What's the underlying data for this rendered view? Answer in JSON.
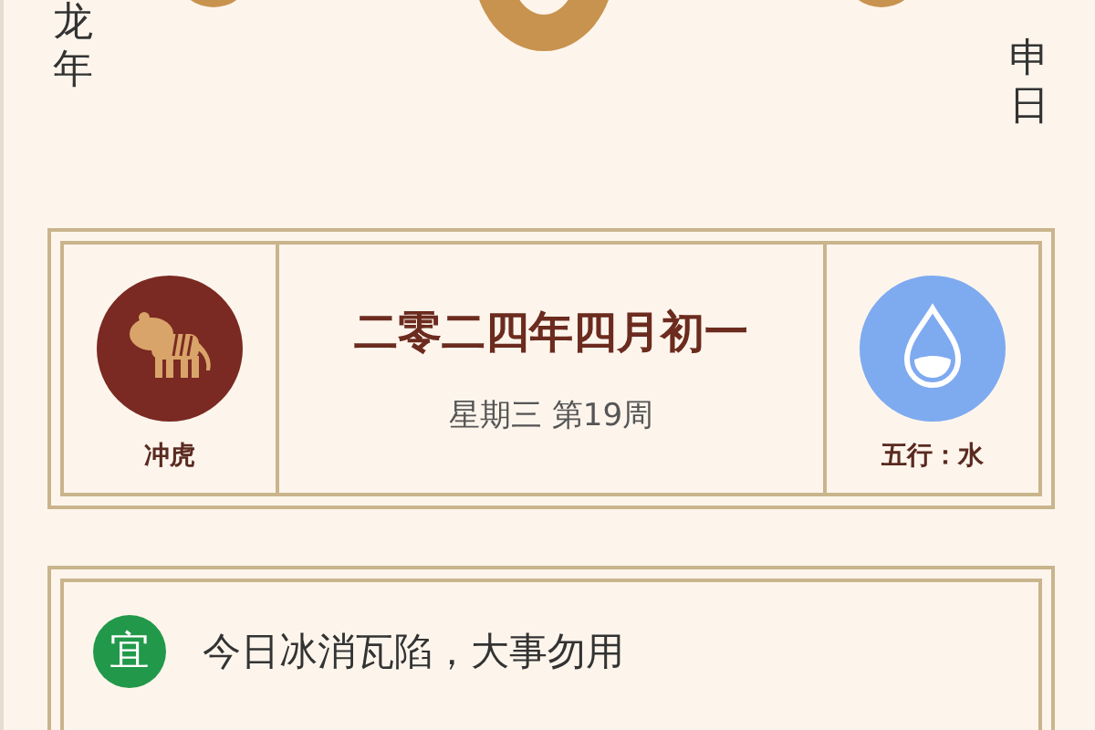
{
  "header": {
    "year_label": "龙年",
    "day_label": "申日"
  },
  "info_card": {
    "clash": "冲虎",
    "date": "二零二四年四月初一",
    "weekday": "星期三 第19周",
    "element": "五行：水"
  },
  "advice": {
    "badge": "宜",
    "text": "今日冰消瓦陷，大事勿用"
  }
}
